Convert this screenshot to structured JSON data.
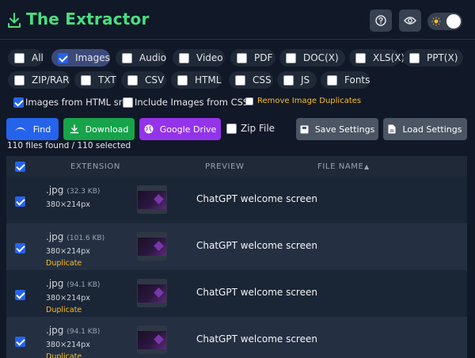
{
  "app": {
    "title": "The Extractor",
    "logo_icon": "download-icon"
  },
  "header_icons": {
    "help": "question-circle-icon",
    "preview": "eye-icon",
    "theme": "sun-icon"
  },
  "filters": [
    {
      "label": "All",
      "checked": false
    },
    {
      "label": "Images",
      "checked": true
    },
    {
      "label": "Audio",
      "checked": false
    },
    {
      "label": "Video",
      "checked": false
    },
    {
      "label": "PDF",
      "checked": false
    },
    {
      "label": "DOC(X)",
      "checked": false
    },
    {
      "label": "XLS(X)",
      "checked": false
    },
    {
      "label": "PPT(X)",
      "checked": false
    },
    {
      "label": "ZIP/RAR",
      "checked": false
    },
    {
      "label": "TXT",
      "checked": false
    },
    {
      "label": "CSV",
      "checked": false
    },
    {
      "label": "HTML",
      "checked": false
    },
    {
      "label": "CSS",
      "checked": false
    },
    {
      "label": "JS",
      "checked": false
    },
    {
      "label": "Fonts",
      "checked": false
    }
  ],
  "options": {
    "html_src": "Images from HTML src",
    "css": "Include Images from CSS",
    "dedupe": "Remove Image Duplicates"
  },
  "actions": {
    "find": "Find",
    "download": "Download",
    "drive": "Google Drive",
    "zip": "Zip File",
    "save": "Save Settings",
    "load": "Load Settings"
  },
  "colors": {
    "find": "#2563eb",
    "download": "#16a34a",
    "drive": "#9333ea",
    "settings": "#4b5563",
    "accent": "#4ade80",
    "duplicate": "#fbbf24"
  },
  "status": "110 files found / 110 selected",
  "table": {
    "headers": {
      "extension": "EXTENSION",
      "preview": "PREVIEW",
      "filename": "FILE NAME",
      "sort": "▲"
    },
    "rows": [
      {
        "ext": ".jpg",
        "size": "(32.3 KB)",
        "dims": "380×214px",
        "dup": "",
        "name": "ChatGPT welcome screen"
      },
      {
        "ext": ".jpg",
        "size": "(101.6 KB)",
        "dims": "380×214px",
        "dup": "Duplicate",
        "name": "ChatGPT welcome screen"
      },
      {
        "ext": ".jpg",
        "size": "(94.1 KB)",
        "dims": "380×214px",
        "dup": "Duplicate",
        "name": "ChatGPT welcome screen"
      },
      {
        "ext": ".jpg",
        "size": "(94.1 KB)",
        "dims": "380×214px",
        "dup": "Duplicate",
        "name": "ChatGPT welcome screen"
      }
    ]
  }
}
